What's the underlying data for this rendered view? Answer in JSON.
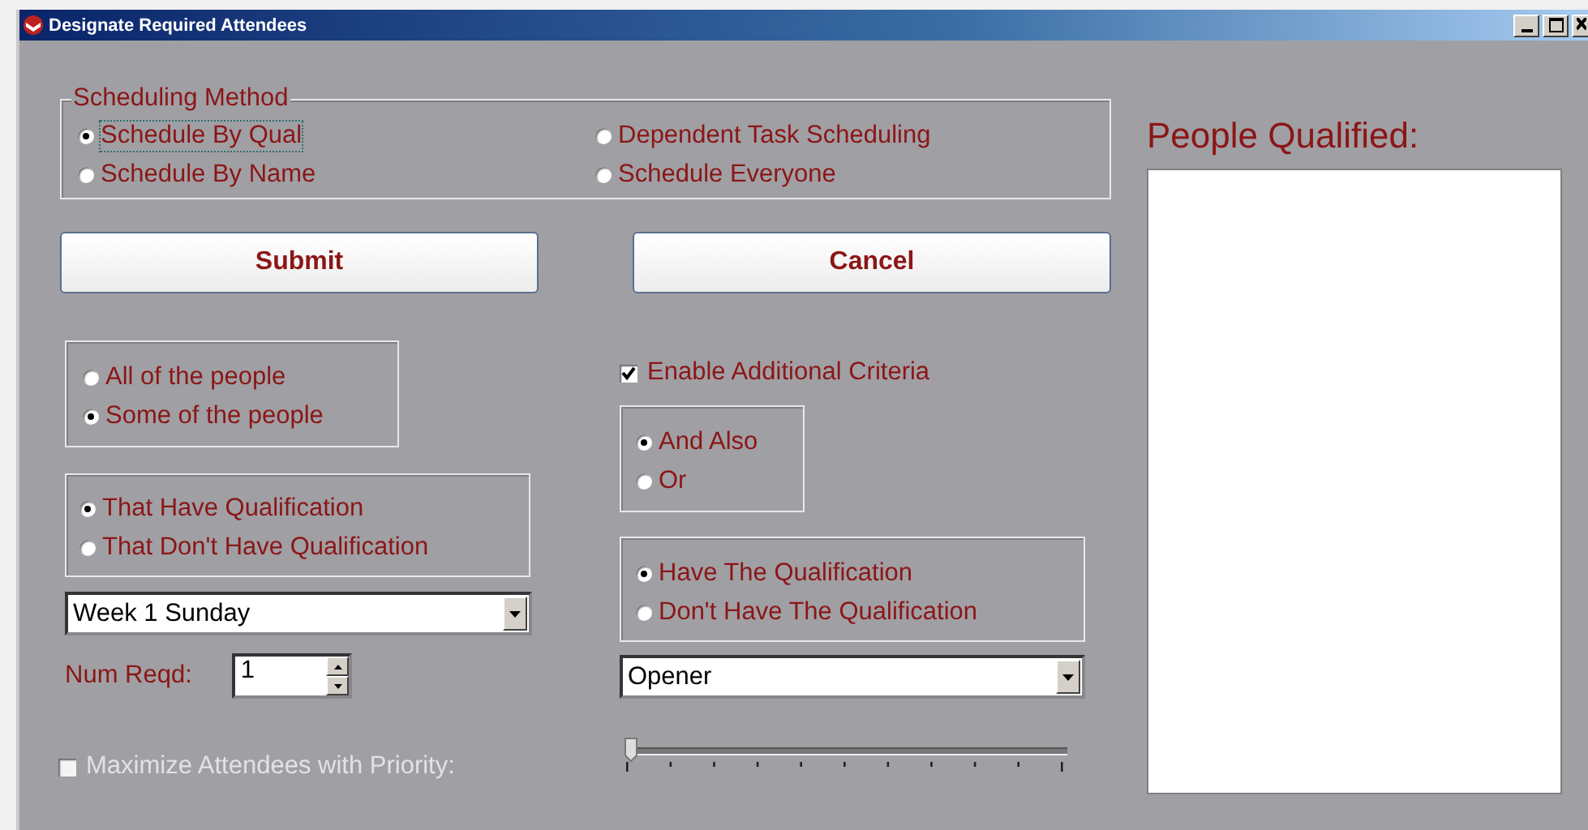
{
  "window": {
    "title": "Designate Required Attendees"
  },
  "scheduling_method": {
    "label": "Scheduling Method",
    "options": [
      {
        "label": "Schedule By Qual",
        "selected": true,
        "focused": true
      },
      {
        "label": "Dependent Task Scheduling",
        "selected": false,
        "focused": false
      },
      {
        "label": "Schedule By Name",
        "selected": false,
        "focused": false
      },
      {
        "label": "Schedule Everyone",
        "selected": false,
        "focused": false
      }
    ]
  },
  "buttons": [
    "Submit",
    "Cancel"
  ],
  "people_scope": [
    {
      "label": "All of the people",
      "selected": false
    },
    {
      "label": "Some of the people",
      "selected": true
    }
  ],
  "qualification_filter": [
    {
      "label": "That Have Qualification",
      "selected": true
    },
    {
      "label": "That Don't Have Qualification",
      "selected": false
    }
  ],
  "shift_dropdown": {
    "value": "Week 1 Sunday"
  },
  "num_reqd": {
    "label": "Num Reqd:",
    "value": "1"
  },
  "maximize_priority": {
    "label": "Maximize Attendees with Priority:",
    "checked": false,
    "disabled": true
  },
  "enable_additional_criteria": {
    "label": "Enable Additional Criteria",
    "checked": true,
    "disabled": false
  },
  "logic_operator": [
    {
      "label": "And Also",
      "selected": true
    },
    {
      "label": "Or",
      "selected": false
    }
  ],
  "additional_qualification": [
    {
      "label": "Have The Qualification",
      "selected": true
    },
    {
      "label": "Don't Have The Qualification",
      "selected": false
    }
  ],
  "qualification_dropdown": {
    "value": "Opener"
  },
  "slider": {
    "level": 0
  },
  "people_qualified": {
    "title": "People Qualified:"
  }
}
